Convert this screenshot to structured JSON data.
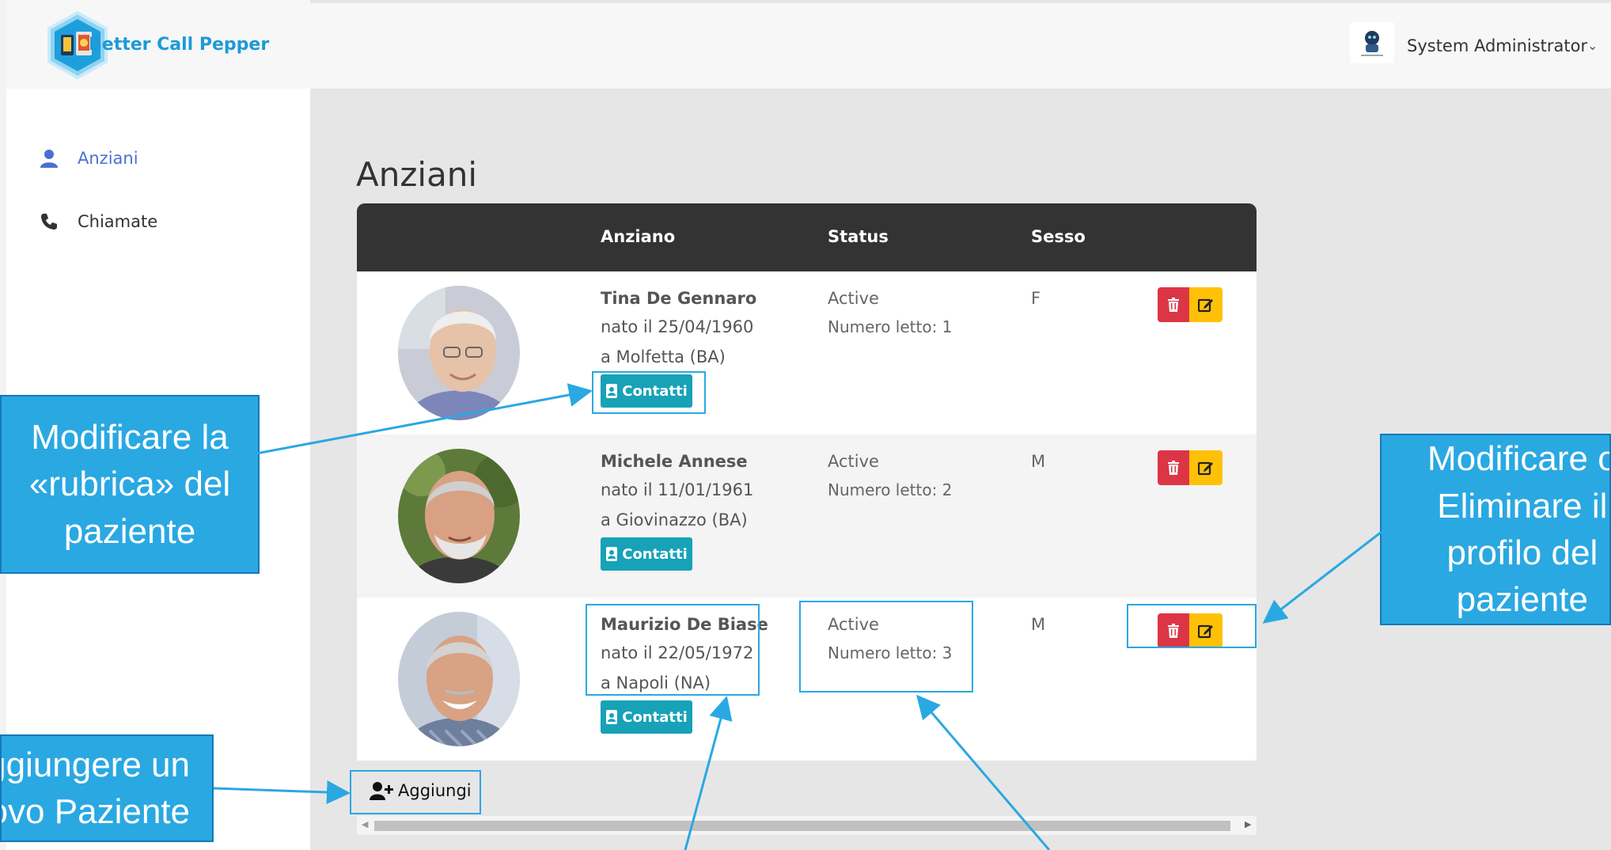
{
  "app": {
    "brand_name": "Better Call Pepper"
  },
  "user": {
    "name": "System Administrator",
    "caret": "⌄"
  },
  "sidebar": {
    "items": [
      {
        "label": "Anziani",
        "icon": "user-icon",
        "active": true
      },
      {
        "label": "Chiamate",
        "icon": "phone-icon",
        "active": false
      }
    ]
  },
  "page": {
    "title": "Anziani"
  },
  "table": {
    "headers": {
      "anziano": "Anziano",
      "status": "Status",
      "sesso": "Sesso"
    },
    "rows": [
      {
        "name": "Tina De Gennaro",
        "born": "nato il 25/04/1960",
        "place": "a Molfetta (BA)",
        "contatti": "Contatti",
        "status": "Active",
        "bed": "Numero letto: 1",
        "sex": "F"
      },
      {
        "name": "Michele Annese",
        "born": "nato il 11/01/1961",
        "place": "a Giovinazzo (BA)",
        "contatti": "Contatti",
        "status": "Active",
        "bed": "Numero letto: 2",
        "sex": "M"
      },
      {
        "name": "Maurizio De Biase",
        "born": "nato il 22/05/1972",
        "place": "a Napoli (NA)",
        "contatti": "Contatti",
        "status": "Active",
        "bed": "Numero letto: 3",
        "sex": "M"
      }
    ],
    "add_label": "Aggiungi"
  },
  "annotations": {
    "left": [
      "Modificare la",
      "«rubrica» del",
      "paziente"
    ],
    "right": [
      "Modificare o",
      "Eliminare il",
      "profilo del",
      "paziente"
    ],
    "bottom": [
      "Aggiungere un",
      "Nuovo Paziente"
    ]
  },
  "colors": {
    "brand": "#1d9ad7",
    "nav_active": "#4a6fd1",
    "header_dark": "#333333",
    "contatti": "#17a2b8",
    "delete": "#dc3545",
    "edit": "#ffc107",
    "callout": "#2aa8e2"
  }
}
